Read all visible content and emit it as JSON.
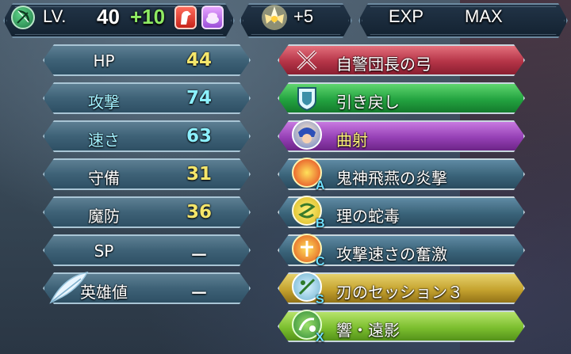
{
  "header": {
    "level_label": "LV.",
    "level": "40",
    "merges": "+10",
    "dragonflowers": "+5",
    "exp_label": "EXP",
    "exp_value": "MAX"
  },
  "stats": [
    {
      "label": "HP",
      "value": "44",
      "value_color": "yellow"
    },
    {
      "label": "攻撃",
      "value": "74",
      "value_color": "blue"
    },
    {
      "label": "速さ",
      "value": "63",
      "value_color": "blue"
    },
    {
      "label": "守備",
      "value": "31",
      "value_color": "yellow"
    },
    {
      "label": "魔防",
      "value": "36",
      "value_color": "yellow"
    },
    {
      "label": "SP",
      "value": "－",
      "value_color": "white"
    },
    {
      "label": "英雄値",
      "value": "－",
      "value_color": "white"
    }
  ],
  "skills": [
    {
      "name": "自警団長の弓",
      "slot": "weapon",
      "letter": "",
      "icon": "weapon-icon"
    },
    {
      "name": "引き戻し",
      "slot": "assist",
      "letter": "",
      "icon": "assist-icon"
    },
    {
      "name": "曲射",
      "slot": "special",
      "letter": "",
      "icon": "special-icon"
    },
    {
      "name": "鬼神飛燕の炎撃",
      "slot": "a",
      "letter": "A",
      "icon": "skill-a-icon"
    },
    {
      "name": "理の蛇毒",
      "slot": "b",
      "letter": "B",
      "icon": "skill-b-icon"
    },
    {
      "name": "攻撃速さの奮激",
      "slot": "c",
      "letter": "C",
      "icon": "skill-c-icon"
    },
    {
      "name": "刃のセッション３",
      "slot": "s",
      "letter": "S",
      "icon": "sacred-seal-icon"
    },
    {
      "name": "響・遠影",
      "slot": "x",
      "letter": "X",
      "icon": "echo-skill-icon"
    }
  ],
  "colors": {
    "stat_yellow": "#f5e66b",
    "stat_blue": "#8cf0ff",
    "merge_green": "#8eea63",
    "slot_letter": "#6fe0ff"
  }
}
